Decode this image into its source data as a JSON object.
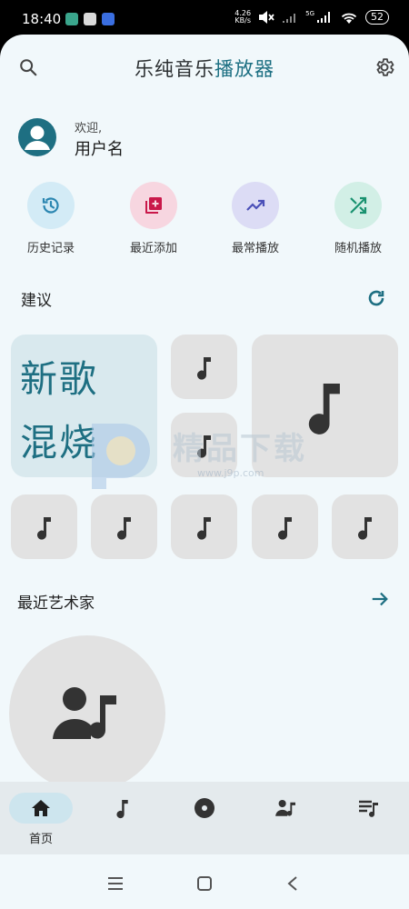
{
  "status_bar": {
    "time": "18:40",
    "net_speed_value": "4.26",
    "net_speed_unit": "KB/s",
    "signal_label": "5G",
    "battery": "52"
  },
  "header": {
    "title_part1": "乐纯音乐",
    "title_part2": "播放器",
    "search_icon": "search-icon",
    "settings_icon": "gear-icon"
  },
  "user": {
    "welcome": "欢迎,",
    "name": "用户名"
  },
  "quick_actions": [
    {
      "label": "历史记录",
      "icon": "history-icon",
      "bg": "#d3ebf6",
      "fg": "#2b86b1"
    },
    {
      "label": "最近添加",
      "icon": "library-add-icon",
      "bg": "#f7d6e0",
      "fg": "#c9184a"
    },
    {
      "label": "最常播放",
      "icon": "trending-up-icon",
      "bg": "#dcdcf5",
      "fg": "#4a4fb8"
    },
    {
      "label": "随机播放",
      "icon": "shuffle-icon",
      "bg": "#d2efe6",
      "fg": "#1a9270"
    }
  ],
  "suggestions": {
    "title": "建议",
    "mix_line1": "新歌",
    "mix_line2": "混烧"
  },
  "recent_artists": {
    "title": "最近艺术家"
  },
  "watermark": {
    "text": "精品下载",
    "url": "www.j9p.com"
  },
  "bottom_nav": [
    {
      "label": "首页",
      "icon": "home-icon",
      "active": true
    },
    {
      "label": "",
      "icon": "music-note-icon",
      "active": false
    },
    {
      "label": "",
      "icon": "album-icon",
      "active": false
    },
    {
      "label": "",
      "icon": "artist-icon",
      "active": false
    },
    {
      "label": "",
      "icon": "playlist-icon",
      "active": false
    }
  ],
  "colors": {
    "accent": "#1e6f82",
    "background": "#f1f8fb",
    "tile": "#e2e2e2"
  }
}
